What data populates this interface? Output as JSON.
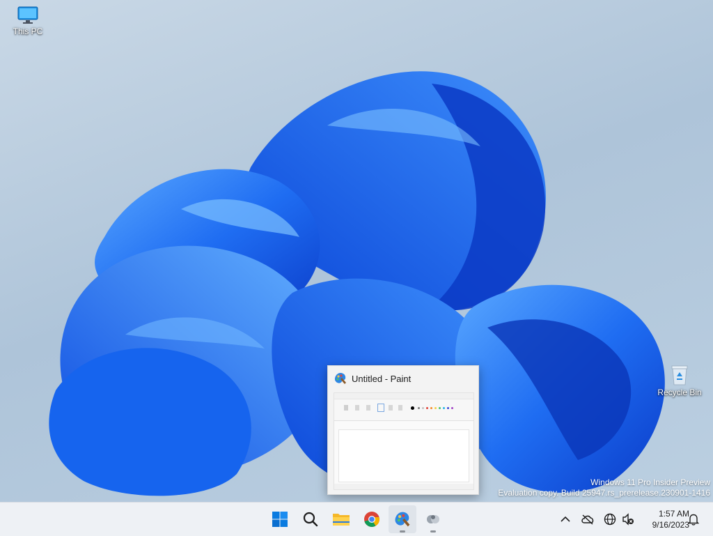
{
  "desktop": {
    "icons": [
      {
        "label": "This PC"
      },
      {
        "label": "Recycle Bin"
      }
    ],
    "watermark": {
      "line1": "Windows 11 Pro Insider Preview",
      "line2": "Evaluation copy. Build 25947.rs_prerelease.230901-1416"
    }
  },
  "preview": {
    "title": "Untitled - Paint",
    "app_icon": "paint-icon"
  },
  "taskbar": {
    "apps": [
      {
        "name": "start",
        "icon": "windows-logo-icon"
      },
      {
        "name": "search",
        "icon": "search-icon"
      },
      {
        "name": "file-explorer",
        "icon": "folder-icon"
      },
      {
        "name": "chrome",
        "icon": "chrome-icon"
      },
      {
        "name": "paint",
        "icon": "paint-icon",
        "active": true
      },
      {
        "name": "unknown-app",
        "icon": "app-icon"
      }
    ],
    "tray": {
      "overflow_icon": "chevron-up-icon",
      "icons": [
        "onedrive-offline-icon",
        "network-globe-icon",
        "volume-muted-icon",
        "notifications-bell-icon"
      ]
    },
    "clock": {
      "time": "1:57 AM",
      "date": "9/16/2023"
    }
  },
  "colors": {
    "accent": "#0067c0",
    "bloom_dark": "#0a3fd6",
    "bloom_light": "#3e8ff7",
    "taskbar_bg": "#eef1f5"
  }
}
